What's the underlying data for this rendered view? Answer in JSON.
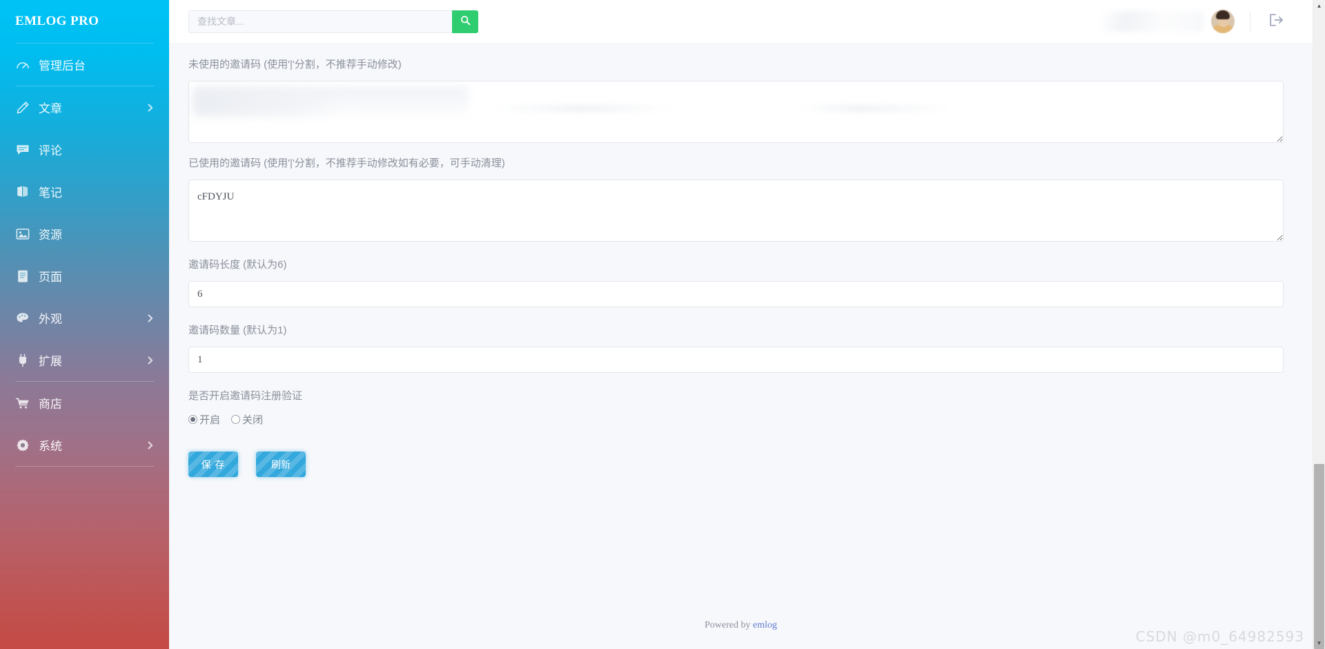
{
  "sidebar": {
    "brand": "EMLOG PRO",
    "items": [
      {
        "label": "管理后台",
        "icon": "dashboard-icon",
        "arrow": false
      },
      {
        "label": "文章",
        "icon": "pencil-icon",
        "arrow": true
      },
      {
        "label": "评论",
        "icon": "comment-icon",
        "arrow": false
      },
      {
        "label": "笔记",
        "icon": "note-icon",
        "arrow": false
      },
      {
        "label": "资源",
        "icon": "image-icon",
        "arrow": false
      },
      {
        "label": "页面",
        "icon": "page-icon",
        "arrow": false
      },
      {
        "label": "外观",
        "icon": "palette-icon",
        "arrow": true
      },
      {
        "label": "扩展",
        "icon": "plug-icon",
        "arrow": true
      },
      {
        "label": "商店",
        "icon": "cart-icon",
        "arrow": false
      },
      {
        "label": "系统",
        "icon": "gear-icon",
        "arrow": true
      }
    ]
  },
  "topbar": {
    "search_placeholder": "查找文章...",
    "search_value": "",
    "search_button_icon": "search-icon",
    "logout_icon": "logout-icon",
    "avatar": "user-avatar"
  },
  "form": {
    "unused_codes": {
      "label": "未使用的邀请码 (使用'|'分割，不推荐手动修改)",
      "value": ""
    },
    "used_codes": {
      "label": "已使用的邀请码 (使用'|'分割，不推荐手动修改如有必要，可手动清理)",
      "value": "cFDYJU"
    },
    "code_length": {
      "label": "邀请码长度 (默认为6)",
      "value": "6"
    },
    "code_count": {
      "label": "邀请码数量 (默认为1)",
      "value": "1"
    },
    "enable_invite": {
      "label": "是否开启邀请码注册验证",
      "options": [
        {
          "label": "开启",
          "checked": true
        },
        {
          "label": "关闭",
          "checked": false
        }
      ]
    },
    "buttons": {
      "save": "保 存",
      "refresh": "刷新"
    }
  },
  "footer": {
    "prefix": "Powered by ",
    "link": "emlog"
  },
  "watermark": "CSDN @m0_64982593",
  "colors": {
    "sidebar_top": "#00c3f5",
    "sidebar_bottom": "#c44a44",
    "search_button": "#2fcc70",
    "primary_button": "#33a8dd",
    "link": "#5f7bd0"
  }
}
